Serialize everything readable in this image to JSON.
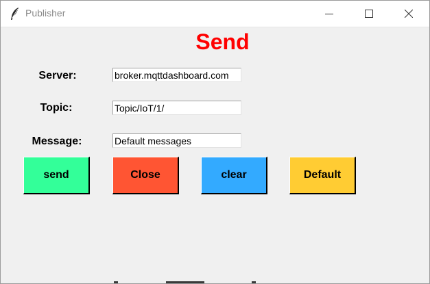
{
  "window": {
    "title": "Publisher",
    "icon": "feather-icon",
    "controls": [
      "minimize-icon",
      "maximize-icon",
      "close-icon"
    ]
  },
  "main": {
    "heading": "Send",
    "heading_color": "#ff0000",
    "fields": {
      "server": {
        "label": "Server:",
        "value": "broker.mqttdashboard.com"
      },
      "topic": {
        "label": "Topic:",
        "value": "Topic/IoT/1/"
      },
      "message": {
        "label": "Message:",
        "value": "Default messages"
      }
    },
    "buttons": {
      "send": {
        "label": "send",
        "color": "#33ff99"
      },
      "close": {
        "label": "Close",
        "color": "#ff5533"
      },
      "clear": {
        "label": "clear",
        "color": "#33aaff"
      },
      "default": {
        "label": "Default",
        "color": "#ffcc33"
      }
    }
  }
}
